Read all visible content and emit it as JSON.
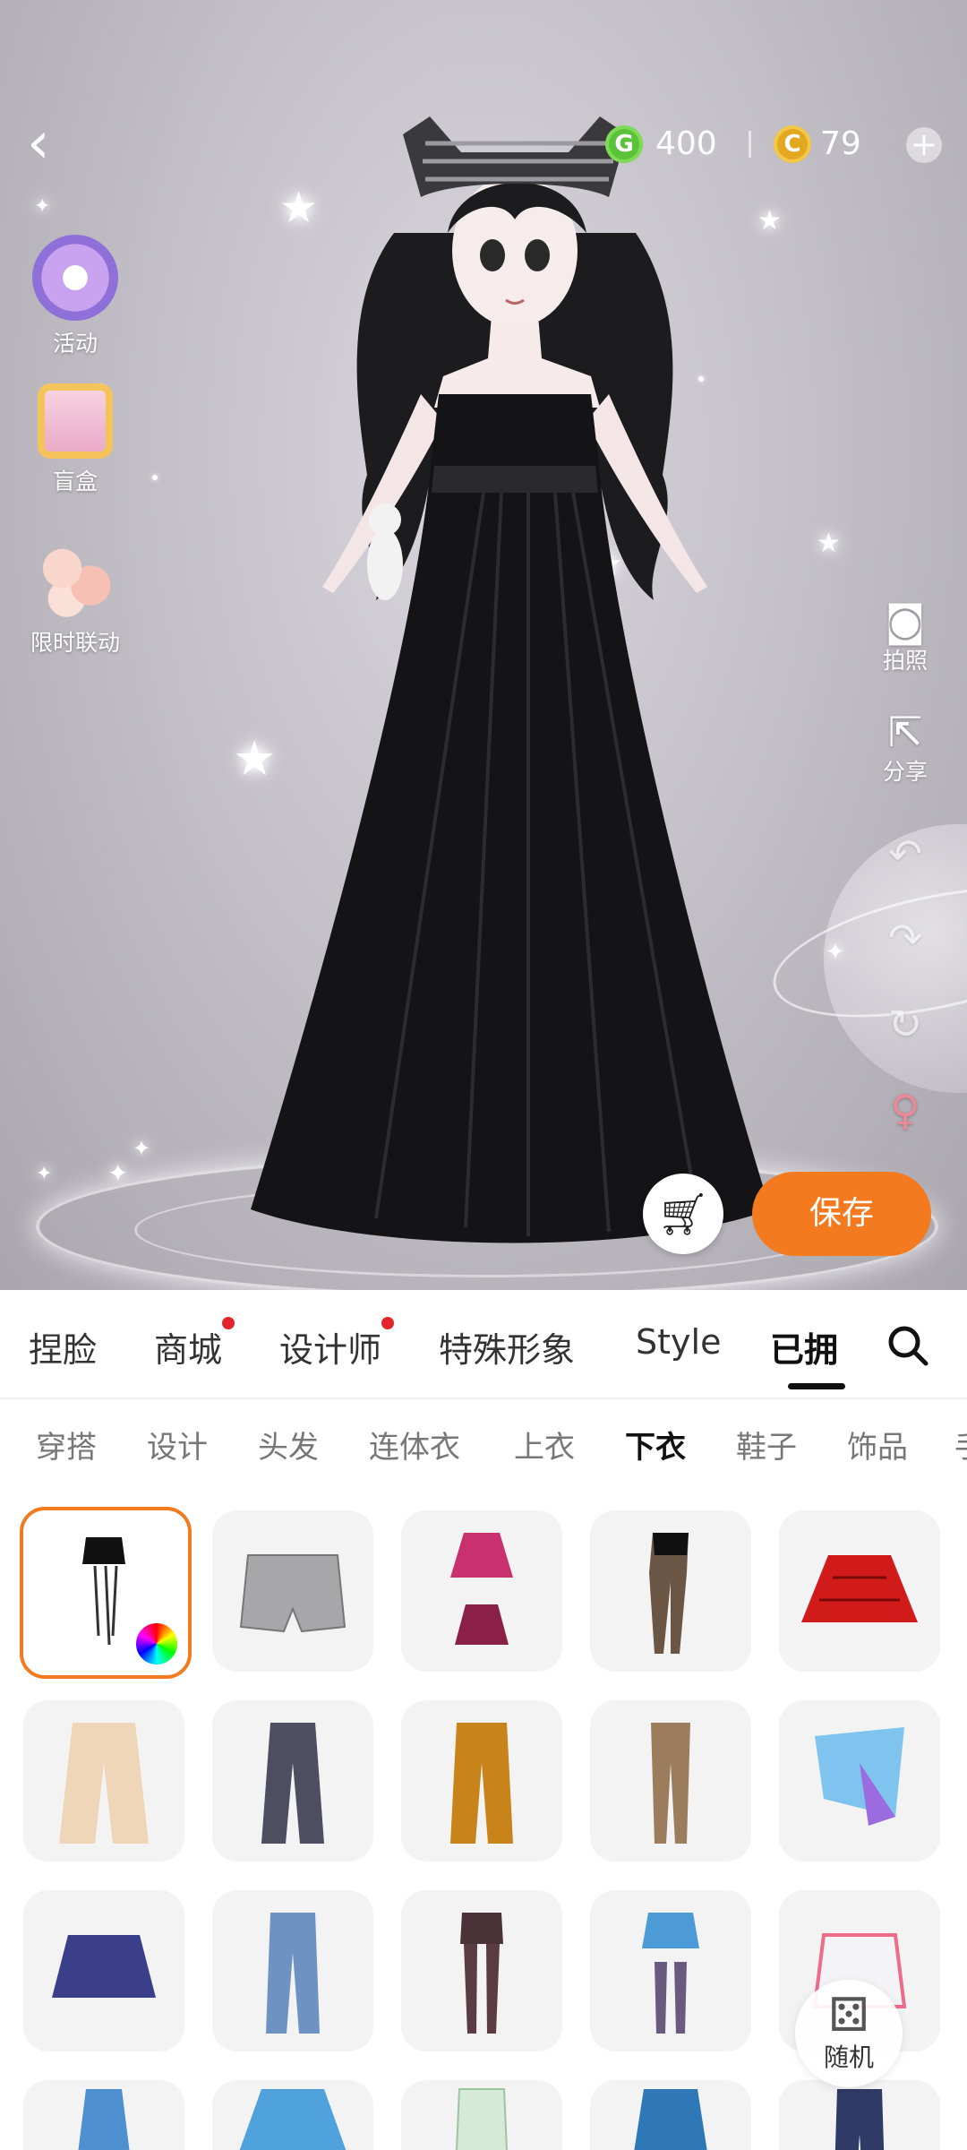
{
  "currency": {
    "green_coin_symbol": "G",
    "green_amount": "400",
    "gold_coin_symbol": "C",
    "gold_amount": "79",
    "add_symbol": "+"
  },
  "left_menu": [
    {
      "label": "活动",
      "icon": "star-badge-icon"
    },
    {
      "label": "盲盒",
      "icon": "gift-box-icon"
    },
    {
      "label": "限时联动",
      "icon": "flower-icon"
    }
  ],
  "right_menu": [
    {
      "label": "拍照",
      "icon": "camera-icon"
    },
    {
      "label": "分享",
      "icon": "share-icon"
    },
    {
      "label": "",
      "icon": "undo-icon"
    },
    {
      "label": "",
      "icon": "redo-icon"
    },
    {
      "label": "",
      "icon": "reset-icon"
    },
    {
      "label": "",
      "icon": "gender-switch-icon"
    }
  ],
  "actions": {
    "save_label": "保存",
    "random_label": "随机"
  },
  "top_tabs": [
    {
      "label": "捏脸",
      "badge": false
    },
    {
      "label": "商城",
      "badge": true
    },
    {
      "label": "设计师",
      "badge": true
    },
    {
      "label": "特殊形象",
      "badge": false
    },
    {
      "label": "Style",
      "badge": false
    },
    {
      "label": "已拥",
      "badge": false,
      "active": true
    }
  ],
  "sub_tabs": [
    {
      "label": "穿搭"
    },
    {
      "label": "设计"
    },
    {
      "label": "头发"
    },
    {
      "label": "连体衣"
    },
    {
      "label": "上衣"
    },
    {
      "label": "下衣",
      "active": true
    },
    {
      "label": "鞋子"
    },
    {
      "label": "饰品"
    },
    {
      "label": "手"
    }
  ],
  "items": [
    {
      "kind": "black-mini-skirt-chains",
      "selected": true,
      "colorable": true
    },
    {
      "kind": "grey-shorts"
    },
    {
      "kind": "pink-frilly-skirt"
    },
    {
      "kind": "black-fishnet-leggings"
    },
    {
      "kind": "red-plaid-skirt"
    },
    {
      "kind": "beige-wide-pants"
    },
    {
      "kind": "dark-flare-pants"
    },
    {
      "kind": "orange-track-pants"
    },
    {
      "kind": "brown-leggings"
    },
    {
      "kind": "blue-wrap-skirt"
    },
    {
      "kind": "navy-skirt"
    },
    {
      "kind": "blue-jeans"
    },
    {
      "kind": "shorts-with-stockings"
    },
    {
      "kind": "blue-skirt-with-stockings"
    },
    {
      "kind": "white-pink-skirt"
    },
    {
      "kind": "blue-long-skirt"
    },
    {
      "kind": "blue-pleated-skirt"
    },
    {
      "kind": "green-pencil-skirt"
    },
    {
      "kind": "blue-a-line-skirt"
    },
    {
      "kind": "dark-jeans"
    }
  ],
  "colors": {
    "accent": "#f47a1f",
    "badge": "#e3242b",
    "green_coin": "#5cc23a",
    "gold_coin": "#e2a81f"
  }
}
